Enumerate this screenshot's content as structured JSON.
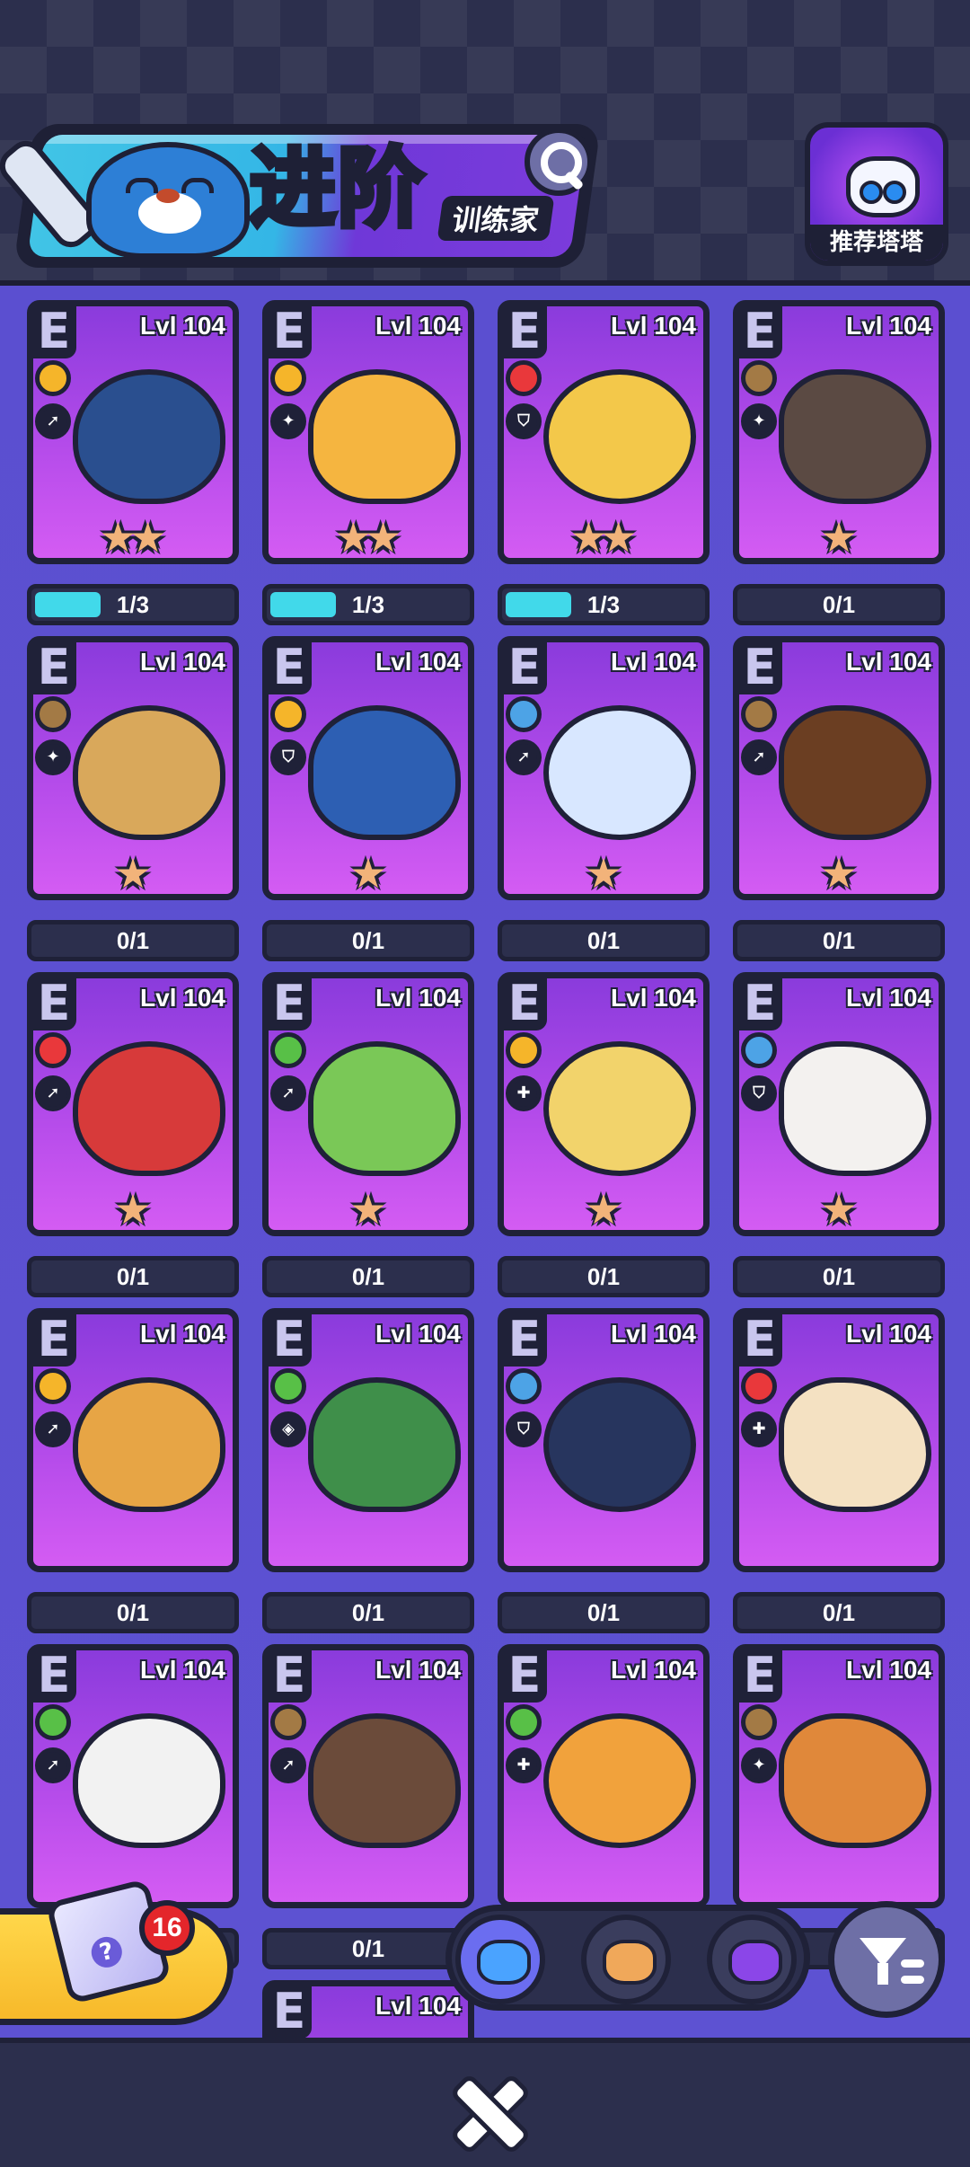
{
  "header": {
    "title": "进阶",
    "subtitle": "训练家",
    "recommend_label": "推荐塔塔"
  },
  "icons": {
    "search": "magnifier-icon",
    "filter": "filter-icon",
    "close": "close-x-icon"
  },
  "colors": {
    "card_bg": "#b44bea",
    "progress_fill": "#41d9ea",
    "electric": "#f5b52a",
    "fire": "#e9383b",
    "earth": "#a37a45",
    "water": "#4da3e6",
    "grass": "#58c047",
    "star": "#f2b37a"
  },
  "monsters": [
    {
      "grade": "E",
      "level": "Lvl 104",
      "type": "electric",
      "role": "attack",
      "stars": 2,
      "progress": "1/3",
      "progress_fraction": 0.333,
      "body": "#2a4f8f"
    },
    {
      "grade": "E",
      "level": "Lvl 104",
      "type": "electric",
      "role": "magic",
      "stars": 2,
      "progress": "1/3",
      "progress_fraction": 0.333,
      "body": "#f5b540"
    },
    {
      "grade": "E",
      "level": "Lvl 104",
      "type": "fire",
      "role": "defense",
      "stars": 2,
      "progress": "1/3",
      "progress_fraction": 0.333,
      "body": "#f3c84a"
    },
    {
      "grade": "E",
      "level": "Lvl 104",
      "type": "earth",
      "role": "magic",
      "stars": 1,
      "progress": "0/1",
      "progress_fraction": 0,
      "body": "#5b4a43"
    },
    {
      "grade": "E",
      "level": "Lvl 104",
      "type": "earth",
      "role": "magic",
      "stars": 1,
      "progress": "0/1",
      "progress_fraction": 0,
      "body": "#d9a85b"
    },
    {
      "grade": "E",
      "level": "Lvl 104",
      "type": "electric",
      "role": "defense",
      "stars": 1,
      "progress": "0/1",
      "progress_fraction": 0,
      "body": "#2d5fb3"
    },
    {
      "grade": "E",
      "level": "Lvl 104",
      "type": "water",
      "role": "attack",
      "stars": 1,
      "progress": "0/1",
      "progress_fraction": 0,
      "body": "#d8e7ff"
    },
    {
      "grade": "E",
      "level": "Lvl 104",
      "type": "earth",
      "role": "attack",
      "stars": 1,
      "progress": "0/1",
      "progress_fraction": 0,
      "body": "#6b3e22"
    },
    {
      "grade": "E",
      "level": "Lvl 104",
      "type": "fire",
      "role": "attack",
      "stars": 1,
      "progress": "0/1",
      "progress_fraction": 0,
      "body": "#d73a3a"
    },
    {
      "grade": "E",
      "level": "Lvl 104",
      "type": "grass",
      "role": "attack",
      "stars": 1,
      "progress": "0/1",
      "progress_fraction": 0,
      "body": "#7ac857"
    },
    {
      "grade": "E",
      "level": "Lvl 104",
      "type": "electric",
      "role": "heal",
      "stars": 1,
      "progress": "0/1",
      "progress_fraction": 0,
      "body": "#f2d36b"
    },
    {
      "grade": "E",
      "level": "Lvl 104",
      "type": "water",
      "role": "defense",
      "stars": 1,
      "progress": "0/1",
      "progress_fraction": 0,
      "body": "#f3f1ef"
    },
    {
      "grade": "E",
      "level": "Lvl 104",
      "type": "electric",
      "role": "attack",
      "stars": 0,
      "progress": "0/1",
      "progress_fraction": 0,
      "body": "#e7a545"
    },
    {
      "grade": "E",
      "level": "Lvl 104",
      "type": "grass",
      "role": "vision",
      "stars": 0,
      "progress": "0/1",
      "progress_fraction": 0,
      "body": "#3f8f4a"
    },
    {
      "grade": "E",
      "level": "Lvl 104",
      "type": "water",
      "role": "defense",
      "stars": 0,
      "progress": "0/1",
      "progress_fraction": 0,
      "body": "#27355e"
    },
    {
      "grade": "E",
      "level": "Lvl 104",
      "type": "fire",
      "role": "heal",
      "stars": 0,
      "progress": "0/1",
      "progress_fraction": 0,
      "body": "#f4e1c2"
    },
    {
      "grade": "E",
      "level": "Lvl 104",
      "type": "grass",
      "role": "attack",
      "stars": 0,
      "progress": "",
      "progress_fraction": 0,
      "body": "#f2f2f2"
    },
    {
      "grade": "E",
      "level": "Lvl 104",
      "type": "earth",
      "role": "attack",
      "stars": 0,
      "progress": "0/1",
      "progress_fraction": 0,
      "body": "#6b4b3a"
    },
    {
      "grade": "E",
      "level": "Lvl 104",
      "type": "grass",
      "role": "heal",
      "stars": 0,
      "progress": "",
      "progress_fraction": 0,
      "body": "#f1a23c"
    },
    {
      "grade": "E",
      "level": "Lvl 104",
      "type": "earth",
      "role": "magic",
      "stars": 0,
      "progress": "0",
      "progress_fraction": 0,
      "body": "#e0883a"
    },
    {
      "grade": "E",
      "level": "Lvl 104",
      "type": "",
      "role": "",
      "stars": 0,
      "progress": "",
      "progress_fraction": 0,
      "body": "#b44bea"
    }
  ],
  "chest": {
    "count": "16"
  },
  "tabs": [
    {
      "name": "tab-blue-cat",
      "active": true,
      "color": "#4aa3ff"
    },
    {
      "name": "tab-hamster",
      "active": false,
      "color": "#f0a85a"
    },
    {
      "name": "tab-star-cat",
      "active": false,
      "color": "#8b46e8"
    }
  ]
}
